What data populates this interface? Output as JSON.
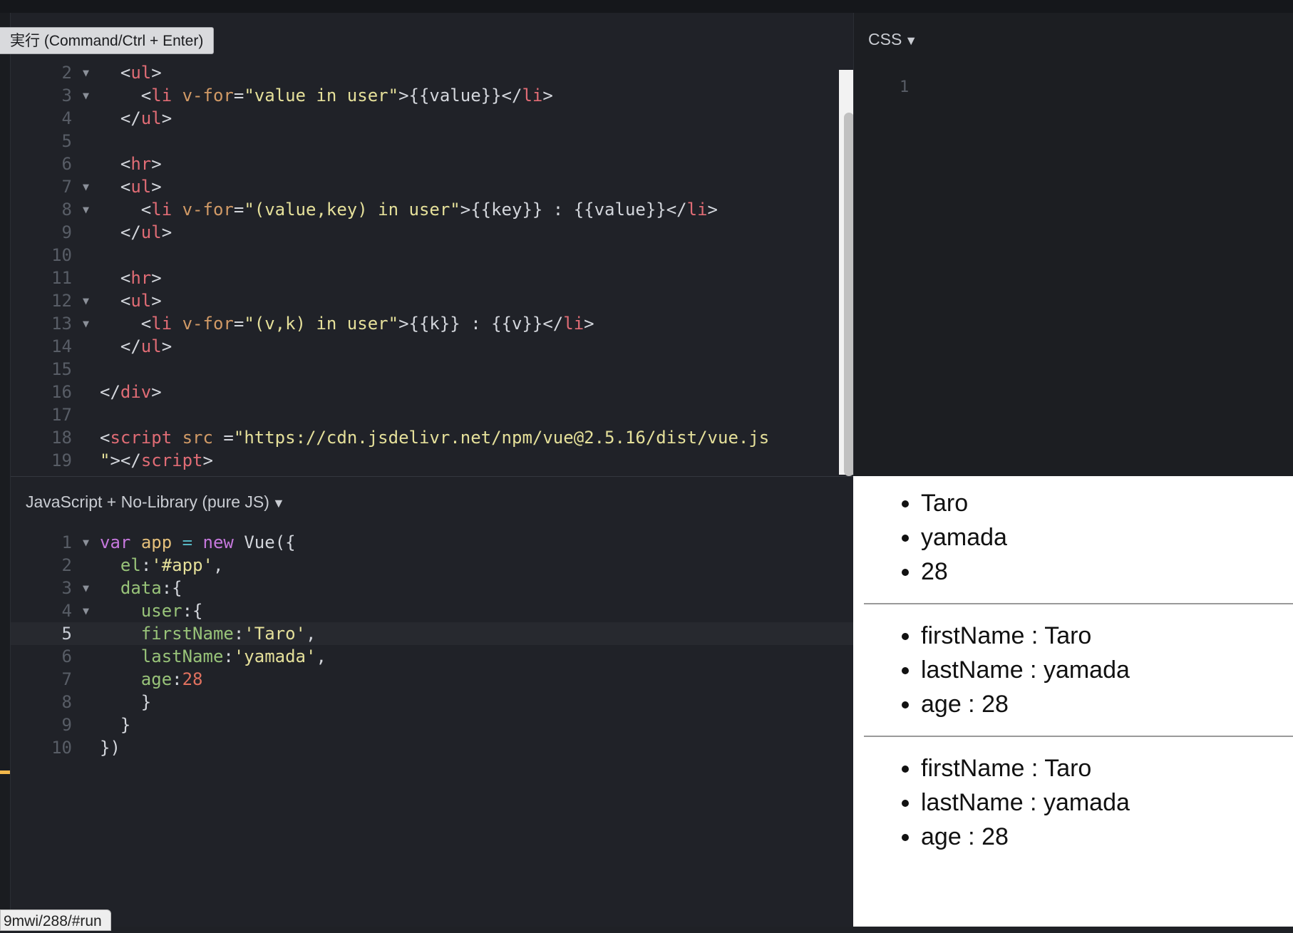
{
  "run_button": "実行 (Command/Ctrl + Enter)",
  "css_panel": {
    "label": "CSS",
    "line_number": "1"
  },
  "js_panel": {
    "label": "JavaScript + No-Library (pure JS)"
  },
  "caret": "▼",
  "fold_glyph": "▼",
  "status_url": "9mwi/288/#run",
  "html_code": [
    {
      "n": "2",
      "fold": true,
      "tokens": [
        [
          "punc",
          "  <"
        ],
        [
          "tag",
          "ul"
        ],
        [
          "punc",
          ">"
        ]
      ]
    },
    {
      "n": "3",
      "fold": true,
      "tokens": [
        [
          "punc",
          "    <"
        ],
        [
          "tag",
          "li"
        ],
        [
          "punc",
          " "
        ],
        [
          "attr",
          "v-for"
        ],
        [
          "punc",
          "="
        ],
        [
          "str",
          "\"value in user\""
        ],
        [
          "punc",
          ">{{value}}</"
        ],
        [
          "tag",
          "li"
        ],
        [
          "punc",
          ">"
        ]
      ]
    },
    {
      "n": "4",
      "fold": false,
      "tokens": [
        [
          "punc",
          "  </"
        ],
        [
          "tag",
          "ul"
        ],
        [
          "punc",
          ">"
        ]
      ]
    },
    {
      "n": "5",
      "fold": false,
      "tokens": []
    },
    {
      "n": "6",
      "fold": false,
      "tokens": [
        [
          "punc",
          "  <"
        ],
        [
          "tag",
          "hr"
        ],
        [
          "punc",
          ">"
        ]
      ]
    },
    {
      "n": "7",
      "fold": true,
      "tokens": [
        [
          "punc",
          "  <"
        ],
        [
          "tag",
          "ul"
        ],
        [
          "punc",
          ">"
        ]
      ]
    },
    {
      "n": "8",
      "fold": true,
      "tokens": [
        [
          "punc",
          "    <"
        ],
        [
          "tag",
          "li"
        ],
        [
          "punc",
          " "
        ],
        [
          "attr",
          "v-for"
        ],
        [
          "punc",
          "="
        ],
        [
          "str",
          "\"(value,key) in user\""
        ],
        [
          "punc",
          ">{{key}} : {{value}}</"
        ],
        [
          "tag",
          "li"
        ],
        [
          "punc",
          ">"
        ]
      ]
    },
    {
      "n": "9",
      "fold": false,
      "tokens": [
        [
          "punc",
          "  </"
        ],
        [
          "tag",
          "ul"
        ],
        [
          "punc",
          ">"
        ]
      ]
    },
    {
      "n": "10",
      "fold": false,
      "tokens": []
    },
    {
      "n": "11",
      "fold": false,
      "tokens": [
        [
          "punc",
          "  <"
        ],
        [
          "tag",
          "hr"
        ],
        [
          "punc",
          ">"
        ]
      ]
    },
    {
      "n": "12",
      "fold": true,
      "tokens": [
        [
          "punc",
          "  <"
        ],
        [
          "tag",
          "ul"
        ],
        [
          "punc",
          ">"
        ]
      ]
    },
    {
      "n": "13",
      "fold": true,
      "tokens": [
        [
          "punc",
          "    <"
        ],
        [
          "tag",
          "li"
        ],
        [
          "punc",
          " "
        ],
        [
          "attr",
          "v-for"
        ],
        [
          "punc",
          "="
        ],
        [
          "str",
          "\"(v,k) in user\""
        ],
        [
          "punc",
          ">{{k}} : {{v}}</"
        ],
        [
          "tag",
          "li"
        ],
        [
          "punc",
          ">"
        ]
      ]
    },
    {
      "n": "14",
      "fold": false,
      "tokens": [
        [
          "punc",
          "  </"
        ],
        [
          "tag",
          "ul"
        ],
        [
          "punc",
          ">"
        ]
      ]
    },
    {
      "n": "15",
      "fold": false,
      "tokens": []
    },
    {
      "n": "16",
      "fold": false,
      "tokens": [
        [
          "punc",
          "</"
        ],
        [
          "tag",
          "div"
        ],
        [
          "punc",
          ">"
        ]
      ]
    },
    {
      "n": "17",
      "fold": false,
      "tokens": []
    },
    {
      "n": "18",
      "fold": false,
      "tokens": [
        [
          "punc",
          "<"
        ],
        [
          "tag",
          "script"
        ],
        [
          "punc",
          " "
        ],
        [
          "attr",
          "src"
        ],
        [
          "punc",
          " ="
        ],
        [
          "str",
          "\"https://cdn.jsdelivr.net/npm/vue@2.5.16/dist/vue.js"
        ]
      ]
    },
    {
      "n": "19",
      "fold": false,
      "tokens": [
        [
          "str",
          "\""
        ],
        [
          "punc",
          "></"
        ],
        [
          "tag",
          "script"
        ],
        [
          "punc",
          ">"
        ]
      ]
    }
  ],
  "js_code": [
    {
      "n": "1",
      "fold": true,
      "tokens": [
        [
          "kw",
          "var"
        ],
        [
          "def",
          " "
        ],
        [
          "var",
          "app"
        ],
        [
          "def",
          " "
        ],
        [
          "op",
          "="
        ],
        [
          "def",
          " "
        ],
        [
          "kw",
          "new"
        ],
        [
          "def",
          " Vue({"
        ]
      ]
    },
    {
      "n": "2",
      "fold": false,
      "tokens": [
        [
          "def",
          "  "
        ],
        [
          "prop",
          "el"
        ],
        [
          "def",
          ":"
        ],
        [
          "str",
          "'#app'"
        ],
        [
          "def",
          ","
        ]
      ]
    },
    {
      "n": "3",
      "fold": true,
      "tokens": [
        [
          "def",
          "  "
        ],
        [
          "prop",
          "data"
        ],
        [
          "def",
          ":{"
        ]
      ]
    },
    {
      "n": "4",
      "fold": true,
      "tokens": [
        [
          "def",
          "    "
        ],
        [
          "prop",
          "user"
        ],
        [
          "def",
          ":{"
        ]
      ]
    },
    {
      "n": "5",
      "fold": false,
      "active": true,
      "tokens": [
        [
          "def",
          "    "
        ],
        [
          "prop",
          "firstName"
        ],
        [
          "def",
          ":"
        ],
        [
          "str",
          "'Taro'"
        ],
        [
          "def",
          ","
        ]
      ]
    },
    {
      "n": "6",
      "fold": false,
      "tokens": [
        [
          "def",
          "    "
        ],
        [
          "prop",
          "lastName"
        ],
        [
          "def",
          ":"
        ],
        [
          "str",
          "'yamada'"
        ],
        [
          "def",
          ","
        ]
      ]
    },
    {
      "n": "7",
      "fold": false,
      "tokens": [
        [
          "def",
          "    "
        ],
        [
          "prop",
          "age"
        ],
        [
          "def",
          ":"
        ],
        [
          "num",
          "28"
        ]
      ]
    },
    {
      "n": "8",
      "fold": false,
      "tokens": [
        [
          "def",
          "    }"
        ]
      ]
    },
    {
      "n": "9",
      "fold": false,
      "tokens": [
        [
          "def",
          "  }"
        ]
      ]
    },
    {
      "n": "10",
      "fold": false,
      "tokens": [
        [
          "def",
          "})"
        ]
      ]
    }
  ],
  "result": {
    "list1": [
      "Taro",
      "yamada",
      "28"
    ],
    "list2": [
      "firstName : Taro",
      "lastName : yamada",
      "age : 28"
    ],
    "list3": [
      "firstName : Taro",
      "lastName : yamada",
      "age : 28"
    ]
  }
}
